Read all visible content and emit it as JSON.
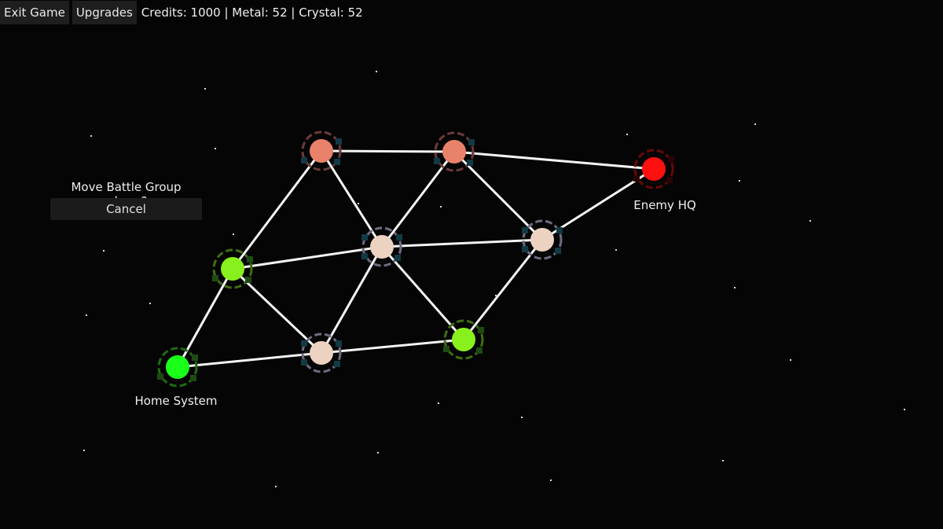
{
  "topbar": {
    "exit_label": "Exit Game",
    "upgrades_label": "Upgrades",
    "resources": "Credits: 1000 | Metal: 52 | Crystal: 52"
  },
  "dialog": {
    "prompt": "Move Battle Group where?",
    "cancel_label": "Cancel"
  },
  "map": {
    "node_labels": {
      "home": "Home System",
      "enemy": "Enemy HQ"
    },
    "colors": {
      "home": "#1aff1a",
      "friendly": "#88f01c",
      "enemy_held": "#e8826a",
      "neutral": "#ecd2c0",
      "enemy_hq": "#ff1010",
      "link": "#f4f4f4",
      "unit": "#123a45"
    }
  }
}
